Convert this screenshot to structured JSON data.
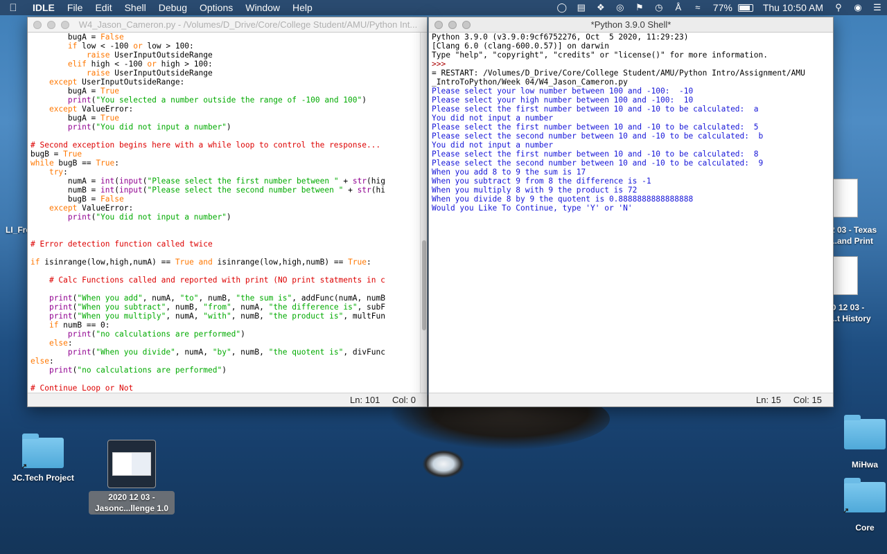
{
  "menubar": {
    "app": "IDLE",
    "items": [
      "File",
      "Edit",
      "Shell",
      "Debug",
      "Options",
      "Window",
      "Help"
    ],
    "battery": "77%",
    "clock": "Thu 10:50 AM"
  },
  "editor": {
    "title": "W4_Jason_Cameron.py - /Volumes/D_Drive/Core/College Student/AMU/Python Int...",
    "status_line": "Ln: 101",
    "status_col": "Col: 0",
    "lines": [
      "        bugA = False",
      "        if low < -100 or low > 100:",
      "            raise UserInputOutsideRange",
      "        elif high < -100 or high > 100:",
      "            raise UserInputOutsideRange",
      "    except UserInputOutsideRange:",
      "        bugA = True",
      "        print(\"You selected a number outside the range of -100 and 100\")",
      "    except ValueError:",
      "        bugA = True",
      "        print(\"You did not input a number\")",
      "",
      "# Second exception begins here with a while loop to control the response...",
      "bugB = True",
      "while bugB == True:",
      "    try:",
      "        numA = int(input(\"Please select the first number between \" + str(hig",
      "        numB = int(input(\"Please select the second number between \" + str(hi",
      "        bugB = False",
      "    except ValueError:",
      "        print(\"You did not input a number\")",
      "",
      "",
      "# Error detection function called twice",
      "",
      "if isinrange(low,high,numA) == True and isinrange(low,high,numB) == True:",
      "",
      "    # Calc Functions called and reported with print (NO print statments in c",
      "",
      "    print(\"When you add\", numA, \"to\", numB, \"the sum is\", addFunc(numA, numB",
      "    print(\"When you subtract\", numB, \"from\", numA, \"the difference is\", subF",
      "    print(\"When you multiply\", numA, \"with\", numB, \"the product is\", multFun",
      "    if numB == 0:",
      "        print(\"no calculations are performed\")",
      "    else:",
      "        print(\"When you divide\", numA, \"by\", numB, \"the quotent is\", divFunc",
      "else:",
      "    print(\"no calculations are performed\")",
      "",
      "# Continue Loop or Not"
    ]
  },
  "shell": {
    "title": "*Python 3.9.0 Shell*",
    "status_line": "Ln: 15",
    "status_col": "Col: 15",
    "lines": [
      {
        "text": "Python 3.9.0 (v3.9.0:9cf6752276, Oct  5 2020, 11:29:23)",
        "kind": "black"
      },
      {
        "text": "[Clang 6.0 (clang-600.0.57)] on darwin",
        "kind": "black"
      },
      {
        "text": "Type \"help\", \"copyright\", \"credits\" or \"license()\" for more information.",
        "kind": "black"
      },
      {
        "text": ">>> ",
        "kind": "prompt"
      },
      {
        "text": "= RESTART: /Volumes/D_Drive/Core/College Student/AMU/Python Intro/Assignment/AMU",
        "kind": "black"
      },
      {
        "text": "_IntroToPython/Week 04/W4_Jason_Cameron.py",
        "kind": "black"
      },
      {
        "text": "Please select your low number between 100 and -100:  -10",
        "kind": "out"
      },
      {
        "text": "Please select your high number between 100 and -100:  10",
        "kind": "out"
      },
      {
        "text": "Please select the first number between 10 and -10 to be calculated:  a",
        "kind": "out"
      },
      {
        "text": "You did not input a number",
        "kind": "out"
      },
      {
        "text": "Please select the first number between 10 and -10 to be calculated:  5",
        "kind": "out"
      },
      {
        "text": "Please select the second number between 10 and -10 to be calculated:  b",
        "kind": "out"
      },
      {
        "text": "You did not input a number",
        "kind": "out"
      },
      {
        "text": "Please select the first number between 10 and -10 to be calculated:  8",
        "kind": "out"
      },
      {
        "text": "Please select the second number between 10 and -10 to be calculated:  9",
        "kind": "out"
      },
      {
        "text": "When you add 8 to 9 the sum is 17",
        "kind": "out"
      },
      {
        "text": "When you subtract 9 from 8 the difference is -1",
        "kind": "out"
      },
      {
        "text": "When you multiply 8 with 9 the product is 72",
        "kind": "out"
      },
      {
        "text": "When you divide 8 by 9 the quotent is 0.8888888888888888",
        "kind": "out"
      },
      {
        "text": "Would you Like To Continue, type 'Y' or 'N'",
        "kind": "out"
      }
    ]
  },
  "desktop": {
    "left_fragment": "LI_Fre",
    "jc_folder": "JC.Tech Project",
    "screenshot_label_1": "2020 12 03 -",
    "screenshot_label_2": "Jasonc...llenge 1.0",
    "right_doc1_l1": "2 03 - Texas",
    "right_doc1_l2": "...and Print",
    "right_doc2_l1": "D 12 03 -",
    "right_doc2_l2": "...t History",
    "mihwa": "MiHwa",
    "core": "Core"
  }
}
